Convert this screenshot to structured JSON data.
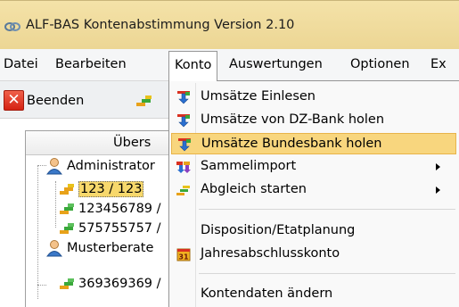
{
  "window": {
    "title": "ALF-BAS Kontenabstimmung Version 2.10",
    "app_icon": "link-chain-icon"
  },
  "menubar": {
    "items": [
      {
        "label": "Datei"
      },
      {
        "label": "Bearbeiten"
      },
      {
        "label": "Konto"
      },
      {
        "label": "Auswertungen"
      },
      {
        "label": "Optionen"
      },
      {
        "label": "Ex"
      }
    ],
    "open_menu": "Konto"
  },
  "toolbar": {
    "quit_label": "Beenden",
    "quit_icon": "close-icon",
    "second_icon": "ledger-icon"
  },
  "panel": {
    "header": "Übers",
    "tree": [
      {
        "label": "Administrator",
        "icon": "user-icon"
      },
      {
        "label": "123 / 123",
        "icon": "ledger-icon",
        "selected": true
      },
      {
        "label": "123456789 /",
        "icon": "ledger-icon"
      },
      {
        "label": "575755757 /",
        "icon": "ledger-icon"
      },
      {
        "label": "Musterberate",
        "icon": "user-icon"
      },
      {
        "label": "369369369 /",
        "icon": "ledger-icon"
      }
    ]
  },
  "dropdown": {
    "items": [
      {
        "label": "Umsätze Einlesen",
        "icon": "import-arrows-icon"
      },
      {
        "label": "Umsätze von DZ-Bank holen",
        "icon": "import-arrows-icon"
      },
      {
        "label": "Umsätze Bundesbank holen",
        "icon": "import-arrows-icon",
        "highlighted": true
      },
      {
        "label": "Sammelimport",
        "icon": "batch-import-icon",
        "submenu": true
      },
      {
        "label": "Abgleich starten",
        "icon": "ledger-icon",
        "submenu": true
      },
      {
        "label": "Disposition/Etatplanung",
        "icon": ""
      },
      {
        "label": "Jahresabschlusskonto",
        "icon": "calendar-31-icon"
      },
      {
        "label": "Kontendaten ändern",
        "icon": ""
      }
    ]
  },
  "colors": {
    "title_bar": "#ecd694",
    "highlight": "#f8d67e",
    "selection": "#f7d86c"
  }
}
